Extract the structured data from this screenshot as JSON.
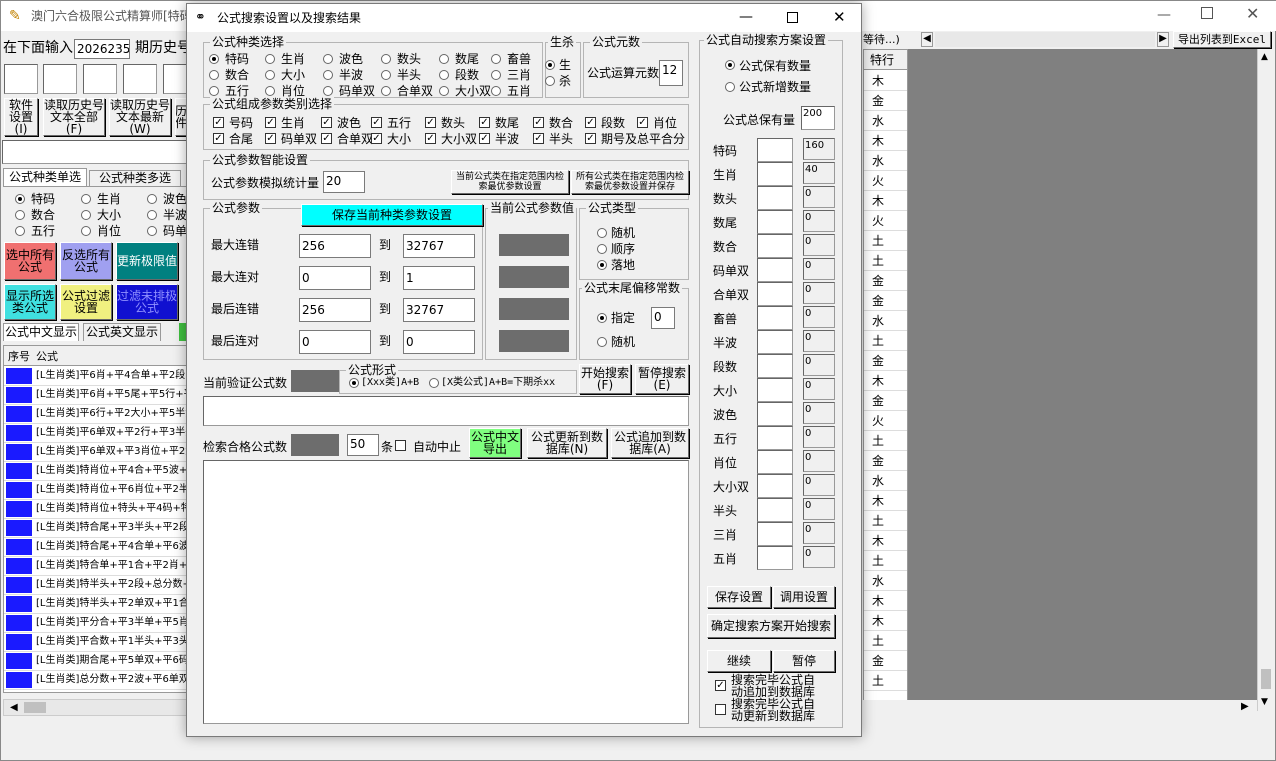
{
  "main_window": {
    "title": "澳门六合极限公式精算师[特码…",
    "input_label": "在下面输入",
    "input_value": "2026235",
    "period_label": "期历史号",
    "buttons": {
      "software_settings": "软件设置(I)",
      "read_history_full": "读取历史号文本全部(F)",
      "read_history_latest": "读取历史号文本最新(W)",
      "partial_fourth": "历件"
    },
    "tabs": {
      "single": "公式种类单选",
      "multi": "公式种类多选"
    },
    "type_radios": [
      "特码",
      "生肖",
      "波色",
      "数合",
      "大小",
      "半波",
      "五行",
      "肖位",
      "码单"
    ],
    "color_buttons": {
      "select_all": "选中所有公式",
      "invert": "反选所有公式",
      "update": "更新极限值",
      "show_selected": "显示所选类公式",
      "filter": "公式过滤设置",
      "filter_low": "过滤未排极公式"
    },
    "lang_tabs": {
      "cn": "公式中文显示",
      "en": "公式英文显示"
    },
    "table_headers": {
      "idx": "序号",
      "formula": "公式"
    },
    "formula_rows": [
      "[L生肖类]平6肖+平4合单+平2段+",
      "[L生肖类]平6肖+平5尾+平5行+平",
      "[L生肖类]平6行+平2大小+平5半波",
      "[L生肖类]平6单双+平2行+平3半头",
      "[L生肖类]平6单双+平3肖位+平2大",
      "[L生肖类]特肖位+平4合+平5波+平",
      "[L生肖类]特肖位+平6肖位+平2半头",
      "[L生肖类]特肖位+特头+平4码+特码",
      "[L生肖类]特合尾+平3半头+平2段+",
      "[L生肖类]特合尾+平4合单+平6波+",
      "[L生肖类]特合单+平1合+平2肖+平",
      "[L生肖类]特半头+平2段+总分数+平",
      "[L生肖类]特半头+平2单双+平1合+",
      "[L生肖类]平分合+平3半单+平5肖位",
      "[L生肖类]平合数+平1半头+平3头+",
      "[L生肖类]期合尾+平5单双+平6码+",
      "[L生肖类]总分数+平2波+平6单双+"
    ],
    "right_toolbar": {
      "partial": "等待...)",
      "export": "导出列表到Excel"
    },
    "right_col_header": "特行",
    "right_col_values": [
      "木",
      "金",
      "水",
      "木",
      "水",
      "火",
      "木",
      "火",
      "土",
      "土",
      "金",
      "金",
      "水",
      "土",
      "金",
      "木",
      "金",
      "火",
      "土",
      "金",
      "水",
      "木",
      "土",
      "木",
      "土",
      "水",
      "木",
      "木",
      "土",
      "金",
      "土",
      "木"
    ]
  },
  "dialog": {
    "title": "公式搜索设置以及搜索结果",
    "formula_type_title": "公式种类选择",
    "formula_types": [
      {
        "label": "特码",
        "on": true
      },
      {
        "label": "生肖",
        "on": false
      },
      {
        "label": "波色",
        "on": false
      },
      {
        "label": "数头",
        "on": false
      },
      {
        "label": "数尾",
        "on": false
      },
      {
        "label": "畜兽",
        "on": false
      },
      {
        "label": "数合",
        "on": false
      },
      {
        "label": "大小",
        "on": false
      },
      {
        "label": "半波",
        "on": false
      },
      {
        "label": "半头",
        "on": false
      },
      {
        "label": "段数",
        "on": false
      },
      {
        "label": "三肖",
        "on": false
      },
      {
        "label": "五行",
        "on": false
      },
      {
        "label": "肖位",
        "on": false
      },
      {
        "label": "码单双",
        "on": false
      },
      {
        "label": "合单双",
        "on": false
      },
      {
        "label": "大小双",
        "on": false
      },
      {
        "label": "五肖",
        "on": false
      }
    ],
    "shengsha_title": "生杀",
    "shengsha": [
      {
        "label": "生",
        "on": true
      },
      {
        "label": "杀",
        "on": false
      }
    ],
    "yuanshu_title": "公式元数",
    "yuanshu_label": "公式运算元数",
    "yuanshu_value": "12",
    "param_type_title": "公式组成参数类别选择",
    "param_types": [
      "号码",
      "生肖",
      "波色",
      "五行",
      "数头",
      "数尾",
      "数合",
      "段数",
      "肖位",
      "合尾",
      "码单双",
      "合单双",
      "大小",
      "大小双",
      "半波",
      "半头",
      "期号及总平合分"
    ],
    "smart_title": "公式参数智能设置",
    "smart_label": "公式参数模拟统计量",
    "smart_value": "20",
    "smart_btn1": "当前公式类在指定范围内检索最优参数设置",
    "smart_btn2": "所有公式类在指定范围内检索最优参数设置并保存",
    "params_title": "公式参数",
    "save_params_btn": "保存当前种类参数设置",
    "to_label": "到",
    "params": [
      {
        "label": "最大连错",
        "from": "256",
        "to": "32767"
      },
      {
        "label": "最大连对",
        "from": "0",
        "to": "1"
      },
      {
        "label": "最后连错",
        "from": "256",
        "to": "32767"
      },
      {
        "label": "最后连对",
        "from": "0",
        "to": "0"
      }
    ],
    "current_param_title": "当前公式参数值",
    "formula_kind_title": "公式类型",
    "formula_kinds": [
      {
        "label": "随机",
        "on": false
      },
      {
        "label": "顺序",
        "on": false
      },
      {
        "label": "落地",
        "on": true
      }
    ],
    "offset_title": "公式末尾偏移常数",
    "offset_specified": "指定",
    "offset_value": "0",
    "offset_random": "随机",
    "verify_label": "当前验证公式数",
    "form_title": "公式形式",
    "form_opt1": "[Xxx类]A+B",
    "form_opt2": "[X类公式]A+B=下期杀xx",
    "start_search_btn": "开始搜索(F)",
    "pause_search_btn": "暂停搜索(E)",
    "qualified_label": "检索合格公式数",
    "qualified_count": "50",
    "tiao_label": "条",
    "auto_stop_label": "自动中止",
    "export_cn_btn": "公式中文导出",
    "update_db_btn": "公式更新到数据库(N)",
    "append_db_btn": "公式追加到数据库(A)",
    "auto_scheme_title": "公式自动搜索方案设置",
    "keep_count_opt": "公式保有数量",
    "add_count_opt": "公式新增数量",
    "total_keep_label": "公式总保有量",
    "total_keep_value": "200",
    "keep_rows": [
      {
        "label": "特码",
        "value": "160"
      },
      {
        "label": "生肖",
        "value": "40"
      },
      {
        "label": "数头",
        "value": "0"
      },
      {
        "label": "数尾",
        "value": "0"
      },
      {
        "label": "数合",
        "value": "0"
      },
      {
        "label": "码单双",
        "value": "0"
      },
      {
        "label": "合单双",
        "value": "0"
      },
      {
        "label": "畜兽",
        "value": "0"
      },
      {
        "label": "半波",
        "value": "0"
      },
      {
        "label": "段数",
        "value": "0"
      },
      {
        "label": "大小",
        "value": "0"
      },
      {
        "label": "波色",
        "value": "0"
      },
      {
        "label": "五行",
        "value": "0"
      },
      {
        "label": "肖位",
        "value": "0"
      },
      {
        "label": "大小双",
        "value": "0"
      },
      {
        "label": "半头",
        "value": "0"
      },
      {
        "label": "三肖",
        "value": "0"
      },
      {
        "label": "五肖",
        "value": "0"
      }
    ],
    "save_settings_btn": "保存设置",
    "load_settings_btn": "调用设置",
    "confirm_start_btn": "确定搜索方案开始搜索",
    "continue_btn": "继续",
    "pause_btn": "暂停",
    "auto_append_label": "搜索完毕公式自动追加到数据库",
    "auto_update_label": "搜索完毕公式自动更新到数据库"
  }
}
